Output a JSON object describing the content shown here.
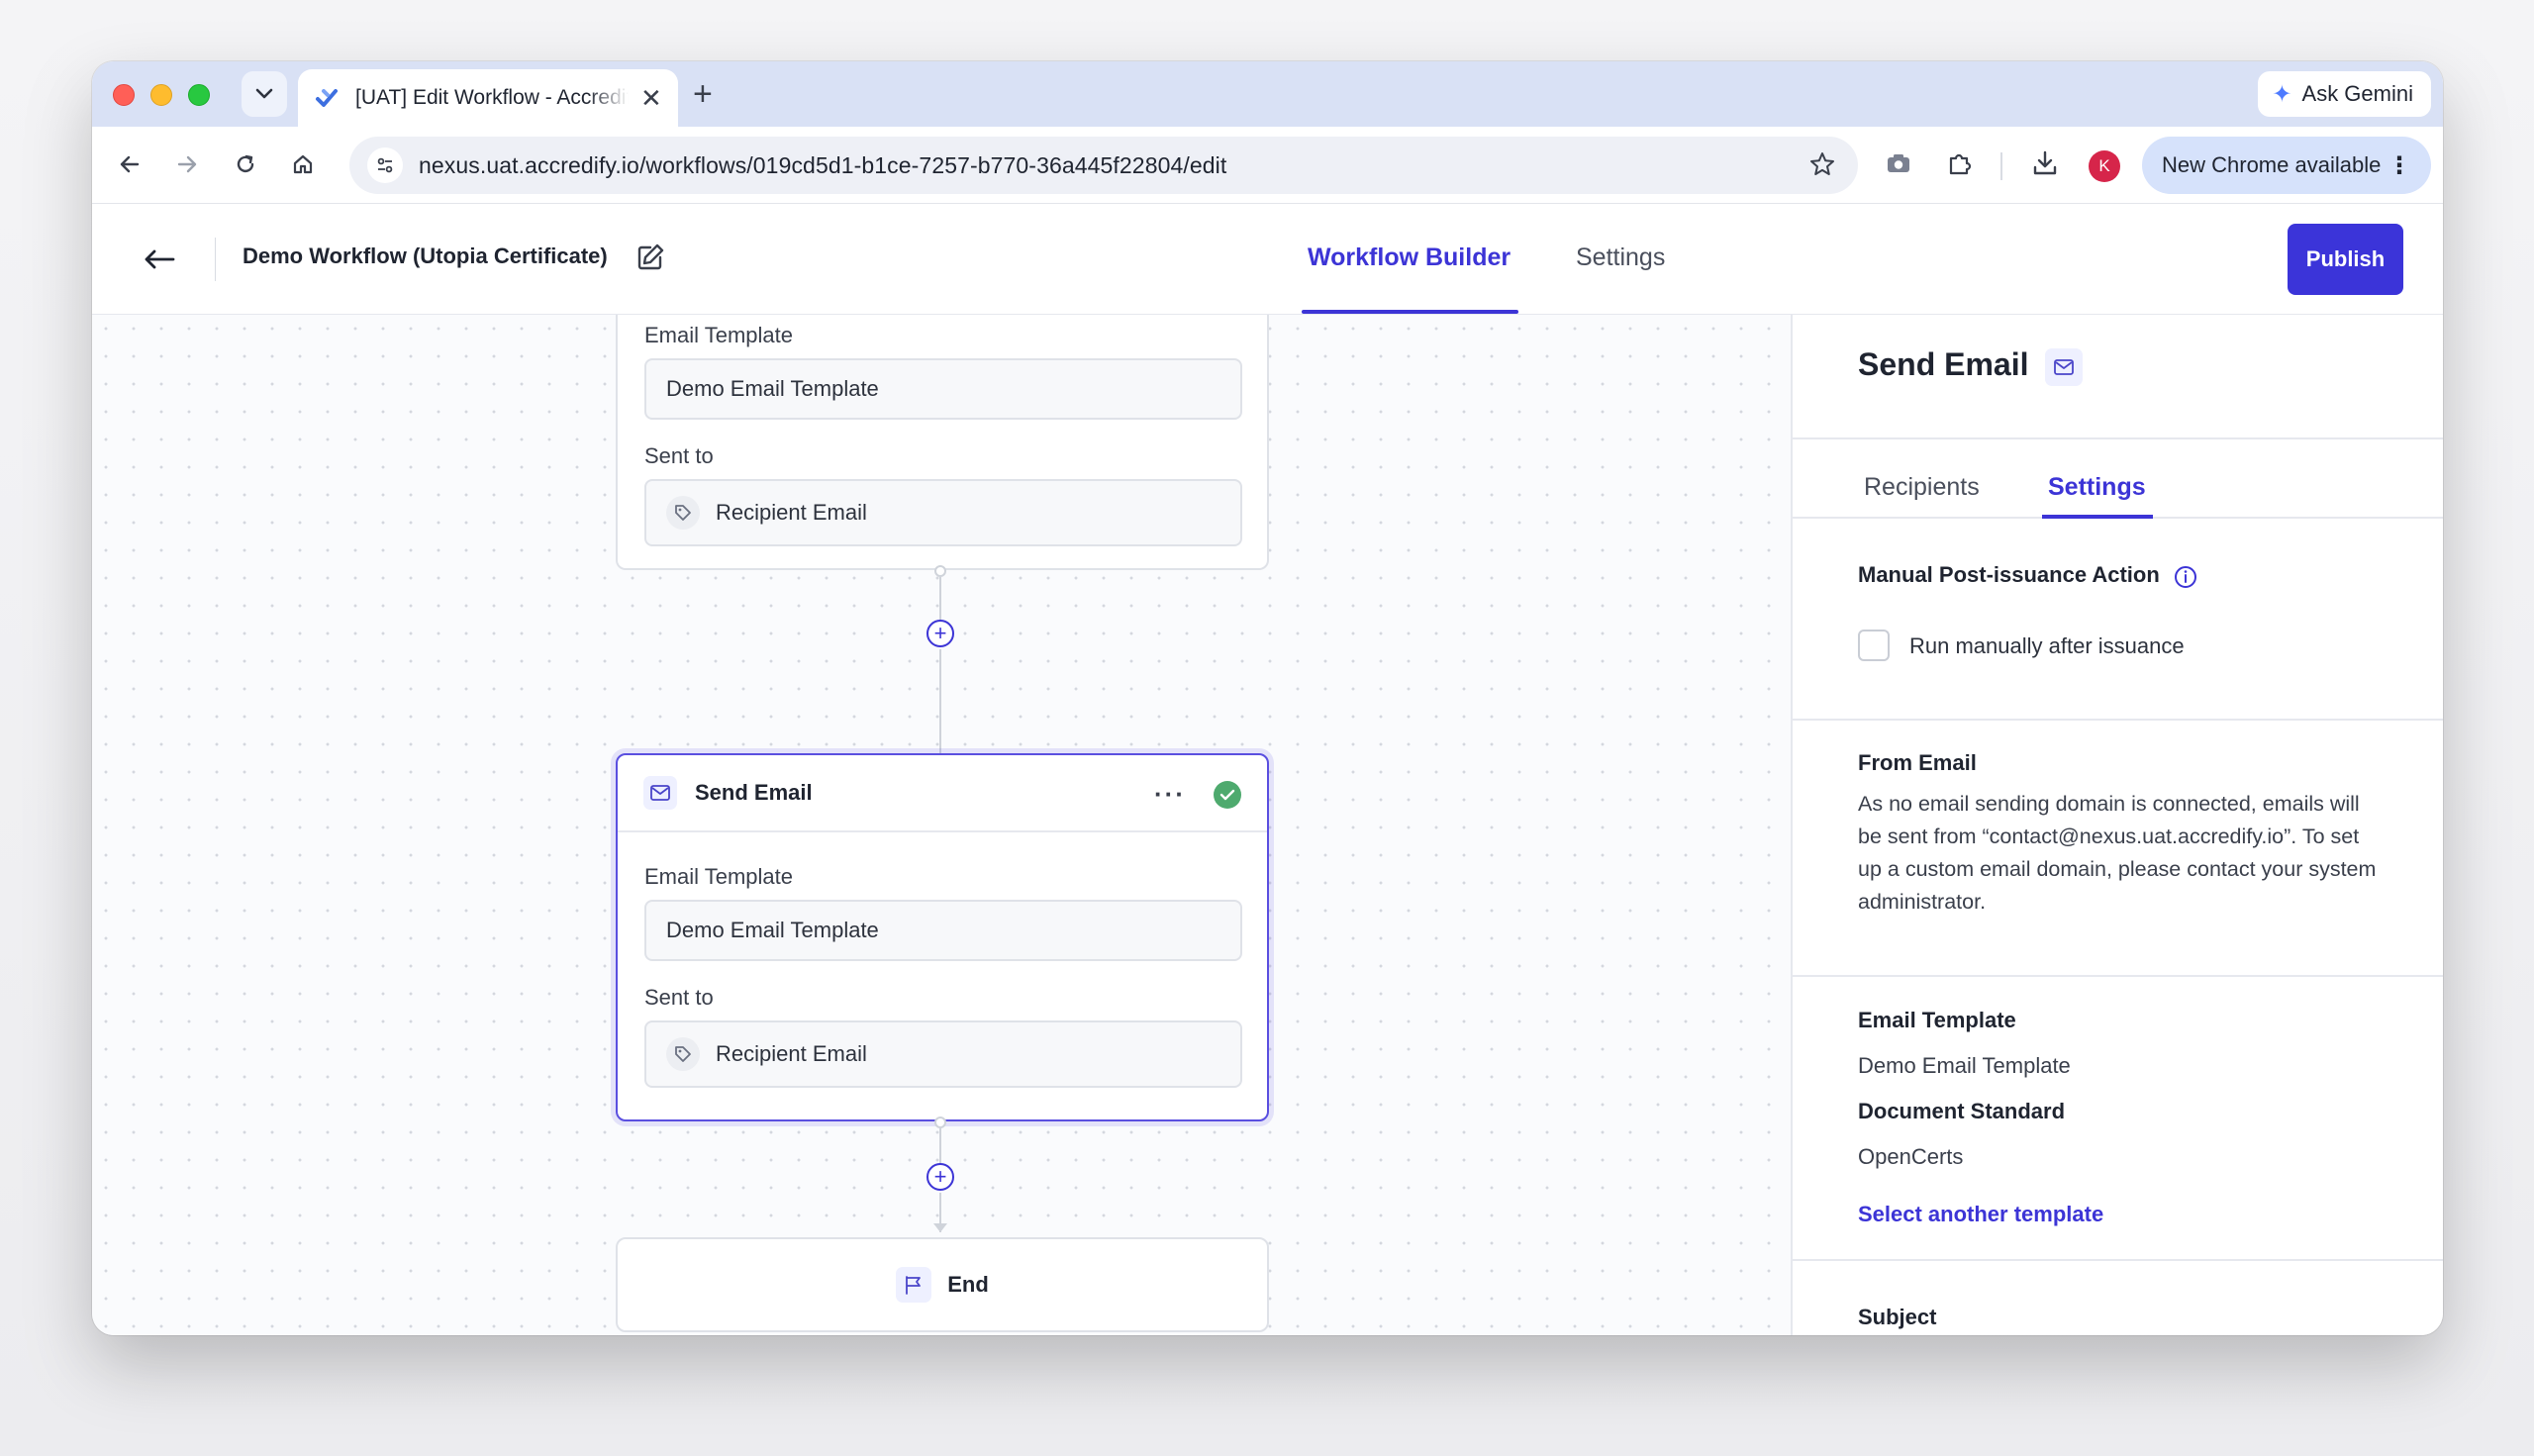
{
  "browser": {
    "tab_title": "[UAT] Edit Workflow - Accredify",
    "new_tab": "+",
    "close": "✕",
    "gemini_label": "Ask Gemini",
    "url": "nexus.uat.accredify.io/workflows/019cd5d1-b1ce-7257-b770-36a445f22804/edit",
    "profile_initial": "K",
    "update_label": "New Chrome available"
  },
  "header": {
    "workflow_title": "Demo Workflow (Utopia Certificate)",
    "tabs": [
      "Workflow Builder",
      "Settings"
    ],
    "publish_label": "Publish"
  },
  "canvas": {
    "top_node": {
      "template_label": "Email Template",
      "template_value": "Demo Email Template",
      "sent_label": "Sent to",
      "sent_value": "Recipient Email"
    },
    "selected_node": {
      "title": "Send Email",
      "menu": "···",
      "template_label": "Email Template",
      "template_value": "Demo Email Template",
      "sent_label": "Sent to",
      "sent_value": "Recipient Email"
    },
    "end_node": {
      "title": "End"
    },
    "add_symbol": "+"
  },
  "panel": {
    "title": "Send Email",
    "tabs": [
      "Recipients",
      "Settings"
    ],
    "manual_heading": "Manual Post-issuance Action",
    "checkbox_label": "Run manually after issuance",
    "from_heading": "From Email",
    "from_text": "As no email sending domain is connected, emails will be sent from “contact@nexus.uat.accredify.io”. To set up a custom email domain, please contact your system administrator.",
    "template_heading": "Email Template",
    "template_value": "Demo Email Template",
    "standard_heading": "Document Standard",
    "standard_value": "OpenCerts",
    "select_link": "Select another template",
    "subject_heading": "Subject"
  },
  "colors": {
    "accent": "#3c34d6",
    "success": "#4eaa6e"
  }
}
